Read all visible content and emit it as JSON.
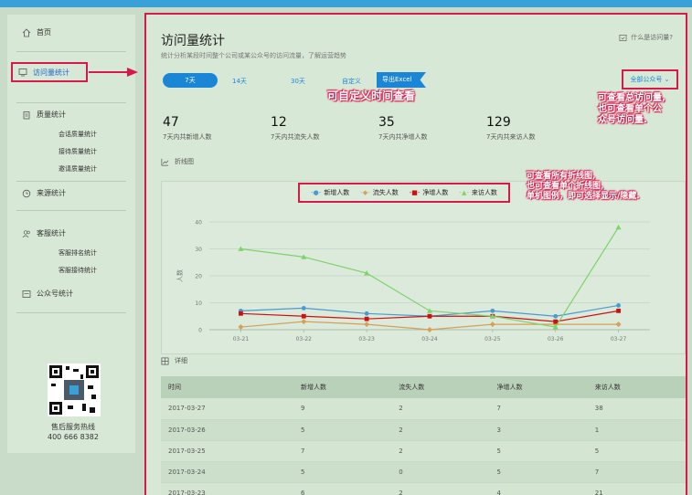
{
  "sidebar": {
    "home": "首页",
    "visit_stats": "访问量统计",
    "quality_stats": "质量统计",
    "quality_sub": [
      "会话质量统计",
      "接待质量统计",
      "邀请质量统计"
    ],
    "source_stats": "来源统计",
    "service_stats": "客服统计",
    "service_sub": [
      "客服排名统计",
      "客服接待统计"
    ],
    "official_stats": "公众号统计",
    "hotline_label": "售后服务热线",
    "hotline_number": "400 666 8382"
  },
  "main": {
    "title": "访问量统计",
    "subtitle": "统计分析某段时间整个公司或某公众号的访问流量，了解运营趋势",
    "help": "什么是访问量?",
    "tabs": [
      "7天",
      "14天",
      "30天",
      "自定义"
    ],
    "export": "导出Excel",
    "account_select": "全部公众号",
    "note_time": "可自定义时间查看",
    "note_total": [
      "可查看总访问量,",
      "也可查看单个公",
      "众号访问量."
    ],
    "note_chart": [
      "可查看所有折线图,",
      "也可查看单个折线图,",
      "单机图例，即可选择显示/隐藏."
    ],
    "stats": [
      {
        "value": "47",
        "label": "7天内共新增人数"
      },
      {
        "value": "12",
        "label": "7天内共流失人数"
      },
      {
        "value": "35",
        "label": "7天内共净增人数"
      },
      {
        "value": "129",
        "label": "7天内共来访人数"
      }
    ],
    "line_section": "折线图",
    "detail_section": "详细"
  },
  "chart_data": {
    "type": "line",
    "x": [
      "03-21",
      "03-22",
      "03-23",
      "03-24",
      "03-25",
      "03-26",
      "03-27"
    ],
    "ylabel": "人数",
    "yticks": [
      "0",
      "10",
      "20",
      "30",
      "40"
    ],
    "ylim": [
      0,
      40
    ],
    "legend_position": "top-center",
    "grid": true,
    "series": [
      {
        "name": "新增人数",
        "color": "#4a9bd0",
        "marker": "circle",
        "values": [
          7,
          8,
          6,
          5,
          7,
          5,
          9
        ]
      },
      {
        "name": "流失人数",
        "color": "#d4a05a",
        "marker": "diamond",
        "values": [
          1,
          3,
          2,
          0,
          2,
          2,
          2
        ]
      },
      {
        "name": "净增人数",
        "color": "#cc1111",
        "marker": "square",
        "values": [
          6,
          5,
          4,
          5,
          5,
          3,
          7
        ]
      },
      {
        "name": "来访人数",
        "color": "#7ed36a",
        "marker": "triangle",
        "values": [
          30,
          27,
          21,
          7,
          5,
          1,
          38
        ]
      }
    ]
  },
  "table": {
    "headers": [
      "时间",
      "新增人数",
      "流失人数",
      "净增人数",
      "来访人数"
    ],
    "rows": [
      [
        "2017-03-27",
        "9",
        "2",
        "7",
        "38"
      ],
      [
        "2017-03-26",
        "5",
        "2",
        "3",
        "1"
      ],
      [
        "2017-03-25",
        "7",
        "2",
        "5",
        "5"
      ],
      [
        "2017-03-24",
        "5",
        "0",
        "5",
        "7"
      ],
      [
        "2017-03-23",
        "6",
        "2",
        "4",
        "21"
      ]
    ]
  },
  "colors": {
    "accent": "#1b86d6",
    "highlight": "#d6194a"
  }
}
